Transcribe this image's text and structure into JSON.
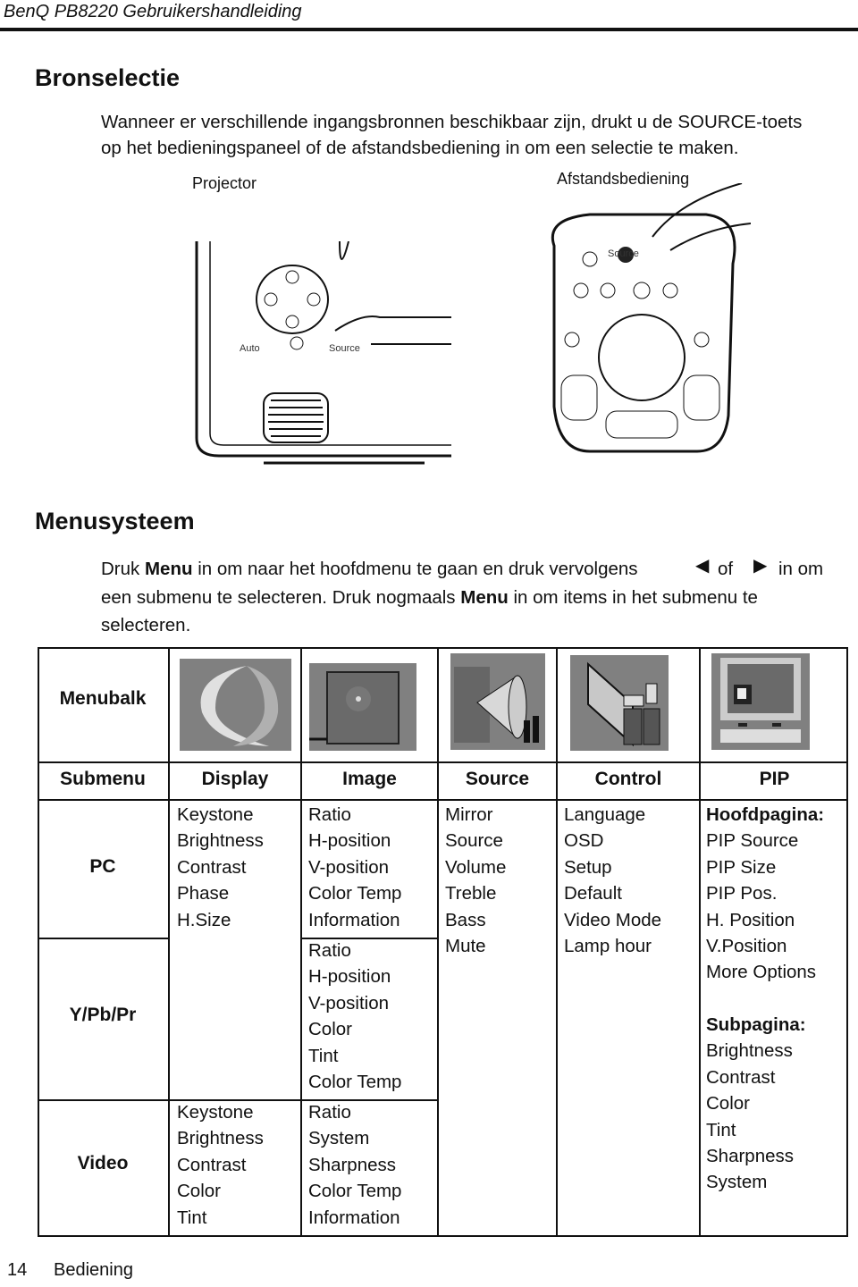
{
  "running_head": "BenQ PB8220 Gebruikershandleiding",
  "section1": {
    "title": "Bronselectie",
    "text_line1": "Wanneer er verschillende ingangsbronnen beschikbaar zijn, drukt u de SOURCE-toets",
    "text_line2": "op het bedieningspaneel of de afstandsbediening in om een selectie te maken.",
    "figure": {
      "projector_label": "Projector",
      "remote_label": "Afstandsbediening",
      "projector_auto": "Auto",
      "projector_source": "Source",
      "remote_source": "Source"
    }
  },
  "section2": {
    "title": "Menusysteem",
    "p1_a": "Druk ",
    "p1_menu": "Menu",
    "p1_b": " in om naar het hoofdmenu te gaan en druk vervolgens ",
    "p1_of": "of",
    "p1_c": "in om",
    "p2_a": "een submenu te selecteren. Druk nogmaals ",
    "p2_menu": "Menu",
    "p2_b": " in om items in het submenu te",
    "p3": "selecteren."
  },
  "table": {
    "menubalk": "Menubalk",
    "submenu": "Submenu",
    "headers": [
      "Display",
      "Image",
      "Source",
      "Control",
      "PIP"
    ],
    "rows": [
      "PC",
      "Y/Pb/Pr",
      "Video"
    ],
    "display_pc": [
      "Keystone",
      "Brightness",
      "Contrast",
      "Phase",
      "H.Size"
    ],
    "display_video": [
      "Keystone",
      "Brightness",
      "Contrast",
      "Color",
      "Tint"
    ],
    "image_pc": [
      "Ratio",
      "H-position",
      "V-position",
      "Color Temp",
      "Information"
    ],
    "image_ypbpr": [
      "Ratio",
      "H-position",
      "V-position",
      "Color",
      "Tint",
      "Color Temp"
    ],
    "image_video": [
      "Ratio",
      "System",
      "Sharpness",
      "Color Temp",
      "Information"
    ],
    "source": [
      "Mirror",
      "Source",
      "Volume",
      "Treble",
      "Bass",
      "Mute"
    ],
    "control": [
      "Language",
      "OSD",
      "Setup",
      "Default",
      "Video Mode",
      "Lamp hour"
    ],
    "pip_main_title": "Hoofdpagina:",
    "pip_main": [
      "PIP Source",
      "PIP Size",
      "PIP Pos.",
      "H. Position",
      "V.Position",
      "More Options"
    ],
    "pip_sub_title": "Subpagina:",
    "pip_sub": [
      "Brightness",
      "Contrast",
      "Color",
      "Tint",
      "Sharpness",
      "System"
    ]
  },
  "footer": {
    "page": "14",
    "section": "Bediening"
  }
}
